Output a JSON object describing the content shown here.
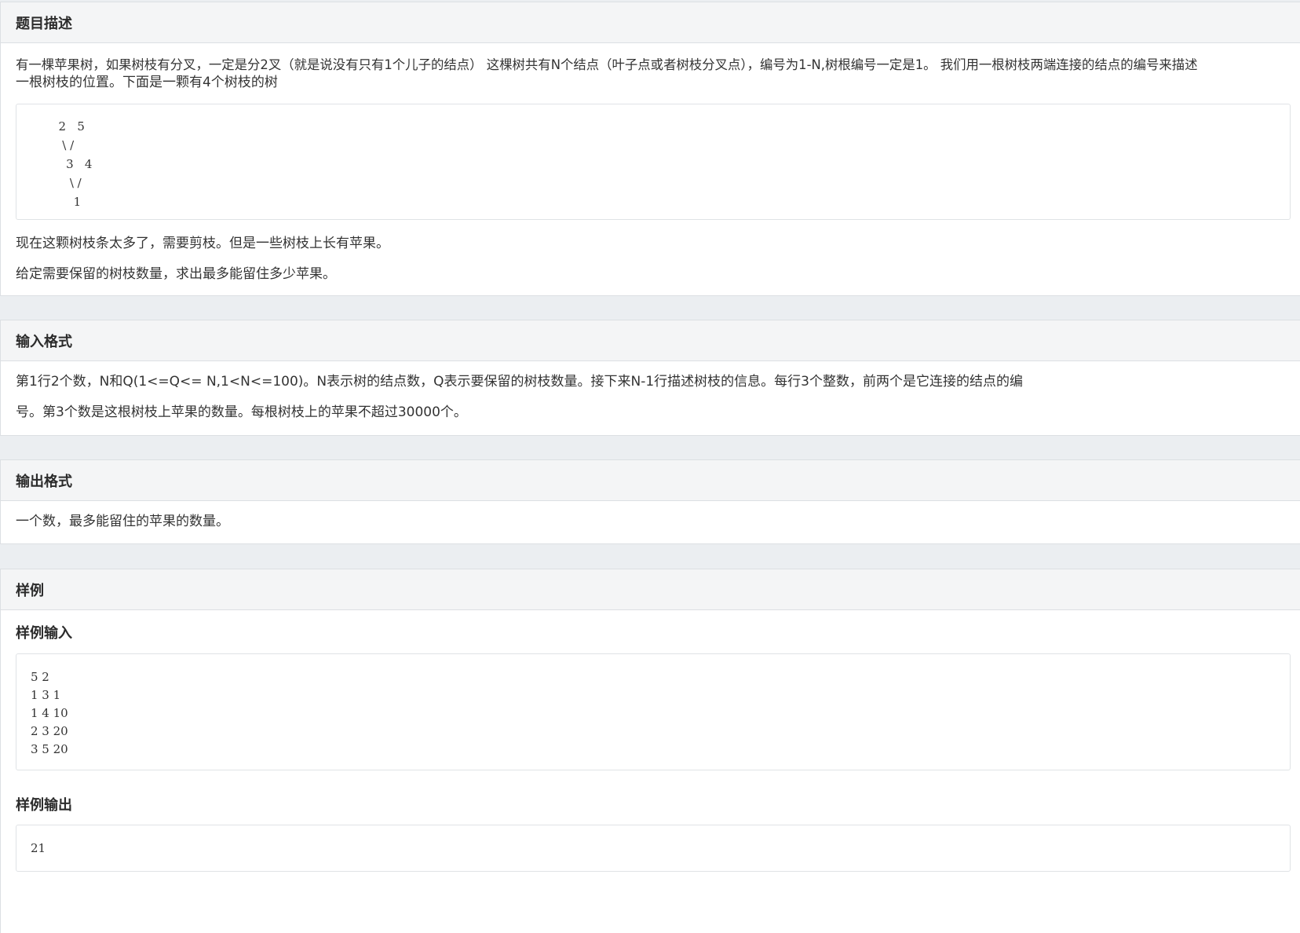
{
  "description": {
    "title": "题目描述",
    "intro_line1": "有一棵苹果树，如果树枝有分叉，一定是分2叉（就是说没有只有1个儿子的结点） 这棵树共有N个结点（叶子点或者树枝分叉点），编号为1-N,树根编号一定是1。 我们用一根树枝两端连接的结点的编号来描述",
    "intro_line2": "一根树枝的位置。下面是一颗有4个树枝的树",
    "tree_diagram": "  2   5\n   \\ /\n    3   4\n     \\ /\n      1",
    "paragraph2": "现在这颗树枝条太多了，需要剪枝。但是一些树枝上长有苹果。",
    "paragraph3": "给定需要保留的树枝数量，求出最多能留住多少苹果。"
  },
  "input_format": {
    "title": "输入格式",
    "line1": "第1行2个数，N和Q(1<=Q<= N,1<N<=100)。N表示树的结点数，Q表示要保留的树枝数量。接下来N-1行描述树枝的信息。每行3个整数，前两个是它连接的结点的编",
    "line2": "号。第3个数是这根树枝上苹果的数量。每根树枝上的苹果不超过30000个。"
  },
  "output_format": {
    "title": "输出格式",
    "text": "一个数，最多能留住的苹果的数量。"
  },
  "sample": {
    "title": "样例",
    "input_title": "样例输入",
    "input_text": "5 2\n1 3 1\n1 4 10\n2 3 20\n3 5 20",
    "output_title": "样例输出",
    "output_text": "21"
  }
}
